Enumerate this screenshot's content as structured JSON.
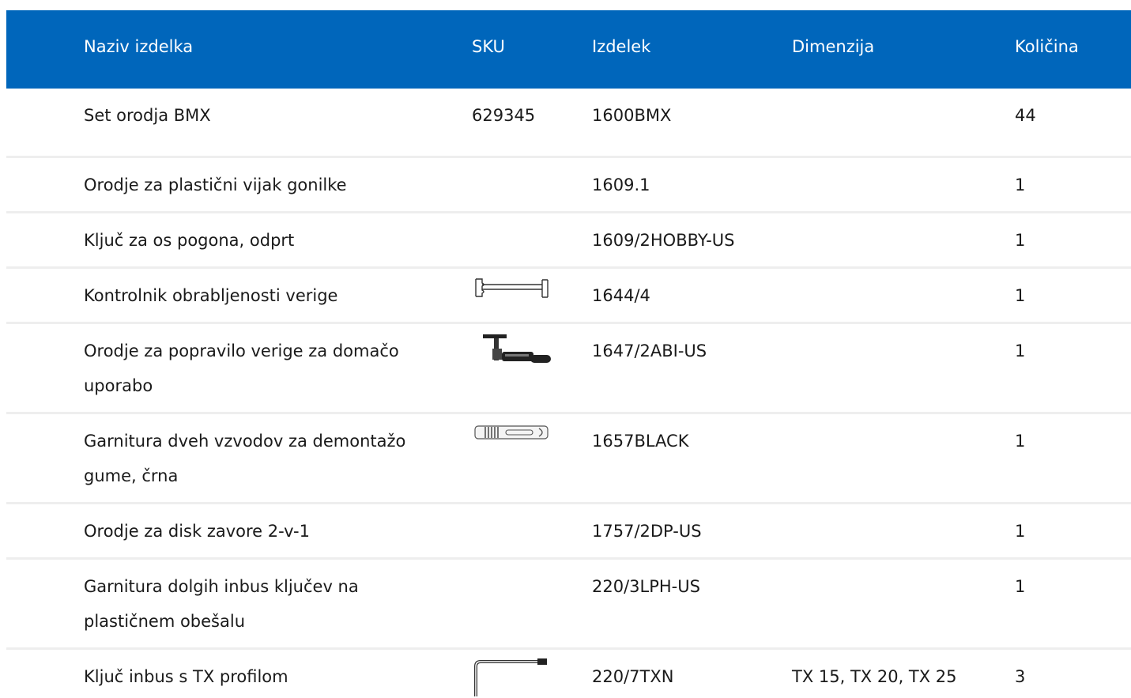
{
  "columns": {
    "name": "Naziv izdelka",
    "sku": "SKU",
    "product": "Izdelek",
    "dimension": "Dimenzija",
    "quantity": "Količina"
  },
  "rows": [
    {
      "name": "Set orodja BMX",
      "sku": "629345",
      "product": "1600BMX",
      "dimension": "",
      "quantity": "44",
      "image": "none"
    },
    {
      "name": "Orodje za plastični vijak gonilke",
      "sku": "",
      "product": "1609.1",
      "dimension": "",
      "quantity": "1",
      "image": "none"
    },
    {
      "name": "Ključ za os pogona, odprt",
      "sku": "",
      "product": "1609/2HOBBY-US",
      "dimension": "",
      "quantity": "1",
      "image": "none"
    },
    {
      "name": "Kontrolnik obrabljenosti verige",
      "sku": "",
      "product": "1644/4",
      "dimension": "",
      "quantity": "1",
      "image": "chain-checker-icon"
    },
    {
      "name": "Orodje za popravilo verige za domačo uporabo",
      "sku": "",
      "product": "1647/2ABI-US",
      "dimension": "",
      "quantity": "1",
      "image": "chain-tool-icon"
    },
    {
      "name": "Garnitura dveh vzvodov za demontažo gume, črna",
      "sku": "",
      "product": "1657BLACK",
      "dimension": "",
      "quantity": "1",
      "image": "tire-lever-icon"
    },
    {
      "name": "Orodje za disk zavore 2-v-1",
      "sku": "",
      "product": "1757/2DP-US",
      "dimension": "",
      "quantity": "1",
      "image": "none"
    },
    {
      "name": "Garnitura dolgih inbus ključev na plastičnem obešalu",
      "sku": "",
      "product": "220/3LPH-US",
      "dimension": "",
      "quantity": "1",
      "image": "none"
    },
    {
      "name": "Ključ inbus s TX profilom",
      "sku": "",
      "product": "220/7TXN",
      "dimension": "TX 15, TX 20, TX 25",
      "quantity": "3",
      "image": "torx-key-icon"
    }
  ],
  "colors": {
    "header_bg": "#0066bb",
    "header_text": "#ffffff",
    "divider": "#eeeeee"
  }
}
